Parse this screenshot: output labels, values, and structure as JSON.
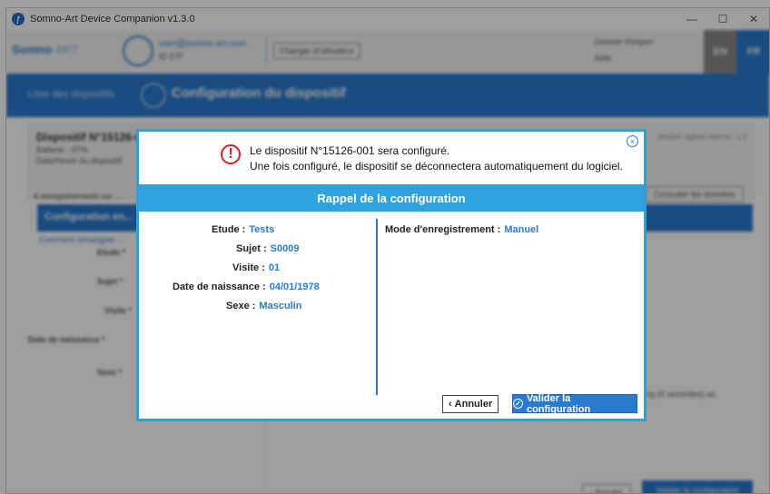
{
  "window": {
    "title": "Somno-Art Device Companion v1.3.0",
    "minimize": "—",
    "maximize": "☐",
    "close": "✕"
  },
  "background": {
    "logo_a": "Somno",
    "logo_b": "ART",
    "user_email": "user@somno-art.com",
    "user_sub": "ID 27F",
    "change_user": "Changer d'utilisateur",
    "option1": "Dossier d'import",
    "option2": "Aide",
    "lang_en": "EN",
    "lang_fr": "FR",
    "crumb_link": "Liste des dispositifs",
    "page_title": "Configuration du dispositif",
    "device_name": "Dispositif N°15126-001",
    "device_battery": "Batterie : 97%",
    "device_date": "Date/heure du dispositif",
    "firmware": "Version logiciel interne : 1.3",
    "recordings": "4 enregistrements sur ...",
    "consult_btn": "Consulter les données",
    "cfg_header": "Configuration en...",
    "cfg_link": "Comment renseigner ...",
    "labels": [
      "Etude *",
      "Sujet *",
      "Visite *",
      "Date de naissance *",
      "Sexe *"
    ],
    "right_text": "ng (4 secondes) au",
    "cancel": "‹ Annuler",
    "validate": "Valider la configuration"
  },
  "modal": {
    "warning_icon": "!",
    "close_icon": "×",
    "message_line1": "Le dispositif N°15126-001 sera configuré.",
    "message_line2": "Une fois configuré, le dispositif se déconnectera automatiquement du logiciel.",
    "header": "Rappel de la configuration",
    "fields": {
      "etude_label": "Etude :",
      "etude_value": "Tests",
      "sujet_label": "Sujet :",
      "sujet_value": "S0009",
      "visite_label": "Visite :",
      "visite_value": "01",
      "naissance_label": "Date de naissance :",
      "naissance_value": "04/01/1978",
      "sexe_label": "Sexe :",
      "sexe_value": "Masculin",
      "mode_label": "Mode d'enregistrement :",
      "mode_value": "Manuel"
    },
    "cancel_arrow": "‹",
    "cancel_label": "Annuler",
    "validate_icon": "✓",
    "validate_label": "Valider la configuration"
  }
}
